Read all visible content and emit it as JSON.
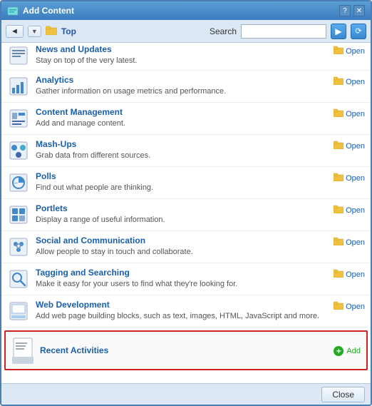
{
  "window": {
    "title": "Add Content",
    "help_btn": "?",
    "close_x_btn": "✕"
  },
  "toolbar": {
    "nav_back_label": "◄",
    "nav_dropdown": "▼",
    "breadcrumb": "Top",
    "search_label": "Search",
    "search_placeholder": "",
    "go_btn": "▶",
    "refresh_btn": "⟳"
  },
  "items": [
    {
      "id": "news-updates",
      "title": "News and Updates",
      "description": "Stay on top of the very latest.",
      "action": "Open",
      "icon_type": "newspaper"
    },
    {
      "id": "analytics",
      "title": "Analytics",
      "description": "Gather information on usage metrics and performance.",
      "action": "Open",
      "icon_type": "analytics"
    },
    {
      "id": "content-management",
      "title": "Content Management",
      "description": "Add and manage content.",
      "action": "Open",
      "icon_type": "content"
    },
    {
      "id": "mash-ups",
      "title": "Mash-Ups",
      "description": "Grab data from different sources.",
      "action": "Open",
      "icon_type": "mashup"
    },
    {
      "id": "polls",
      "title": "Polls",
      "description": "Find out what people are thinking.",
      "action": "Open",
      "icon_type": "polls"
    },
    {
      "id": "portlets",
      "title": "Portlets",
      "description": "Display a range of useful information.",
      "action": "Open",
      "icon_type": "portlets"
    },
    {
      "id": "social-communication",
      "title": "Social and Communication",
      "description": "Allow people to stay in touch and collaborate.",
      "action": "Open",
      "icon_type": "social"
    },
    {
      "id": "tagging-searching",
      "title": "Tagging and Searching",
      "description": "Make it easy for your users to find what they're looking for.",
      "action": "Open",
      "icon_type": "search"
    },
    {
      "id": "web-development",
      "title": "Web Development",
      "description": "Add web page building blocks, such as text, images, HTML, JavaScript and more.",
      "action": "Open",
      "icon_type": "web"
    }
  ],
  "highlighted_item": {
    "title": "Recent Activities",
    "action": "Add",
    "icon_type": "recent"
  },
  "footer": {
    "close_label": "Close"
  }
}
